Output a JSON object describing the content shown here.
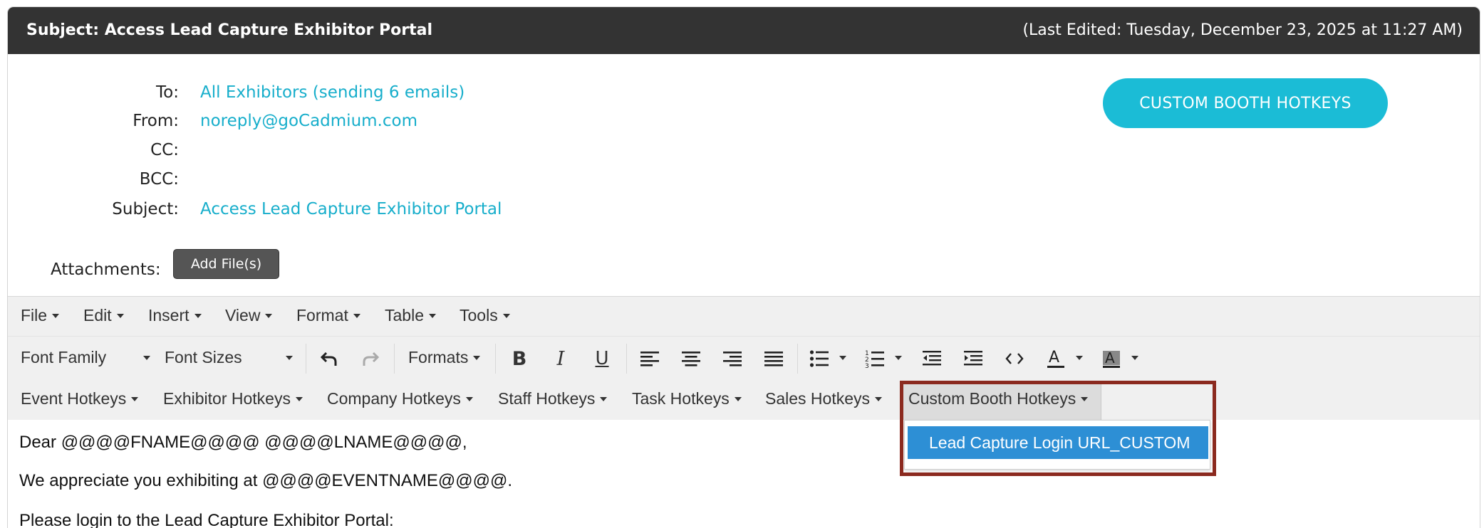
{
  "header": {
    "subject_title": "Subject: Access Lead Capture Exhibitor Portal",
    "last_edited": "(Last Edited: Tuesday, December 23, 2025 at 11:27 AM)",
    "background_color": "#333333"
  },
  "fields": {
    "to_label": "To:",
    "to_value": "All Exhibitors (sending 6 emails)",
    "from_label": "From:",
    "from_value": "noreply@goCadmium.com",
    "cc_label": "CC:",
    "cc_value": "",
    "bcc_label": "BCC:",
    "bcc_value": "",
    "subject_label": "Subject:",
    "subject_value": "Access Lead Capture Exhibitor Portal",
    "link_color": "#17aecb"
  },
  "custom_button": {
    "label": "CUSTOM BOOTH HOTKEYS",
    "color": "#1bbcd6"
  },
  "attachments": {
    "label": "Attachments:",
    "button_label": "Add File(s)"
  },
  "toolbar": {
    "menu": [
      "File",
      "Edit",
      "Insert",
      "View",
      "Format",
      "Table",
      "Tools"
    ],
    "font_family": "Font Family",
    "font_sizes": "Font Sizes",
    "formats": "Formats",
    "icons": [
      "undo-icon",
      "redo-icon",
      "bold-icon",
      "italic-icon",
      "underline-icon",
      "align-left-icon",
      "align-center-icon",
      "align-right-icon",
      "align-justify-icon",
      "bullet-list-icon",
      "numbered-list-icon",
      "outdent-icon",
      "indent-icon",
      "code-icon",
      "text-color-icon",
      "background-color-icon"
    ],
    "hotkeys": [
      "Event Hotkeys",
      "Exhibitor Hotkeys",
      "Company Hotkeys",
      "Staff Hotkeys",
      "Task Hotkeys",
      "Sales Hotkeys",
      "Custom Booth Hotkeys"
    ]
  },
  "dropdown": {
    "items": [
      "Lead Capture Login URL_CUSTOM"
    ],
    "highlight_color": "#2d8fd5",
    "annotation_box_color": "#8b2a1f"
  },
  "body": {
    "lines": [
      "Dear @@@@FNAME@@@@ @@@@LNAME@@@@,",
      "We appreciate you exhibiting at @@@@EVENTNAME@@@@.",
      "Please login to the Lead Capture Exhibitor Portal:"
    ]
  }
}
